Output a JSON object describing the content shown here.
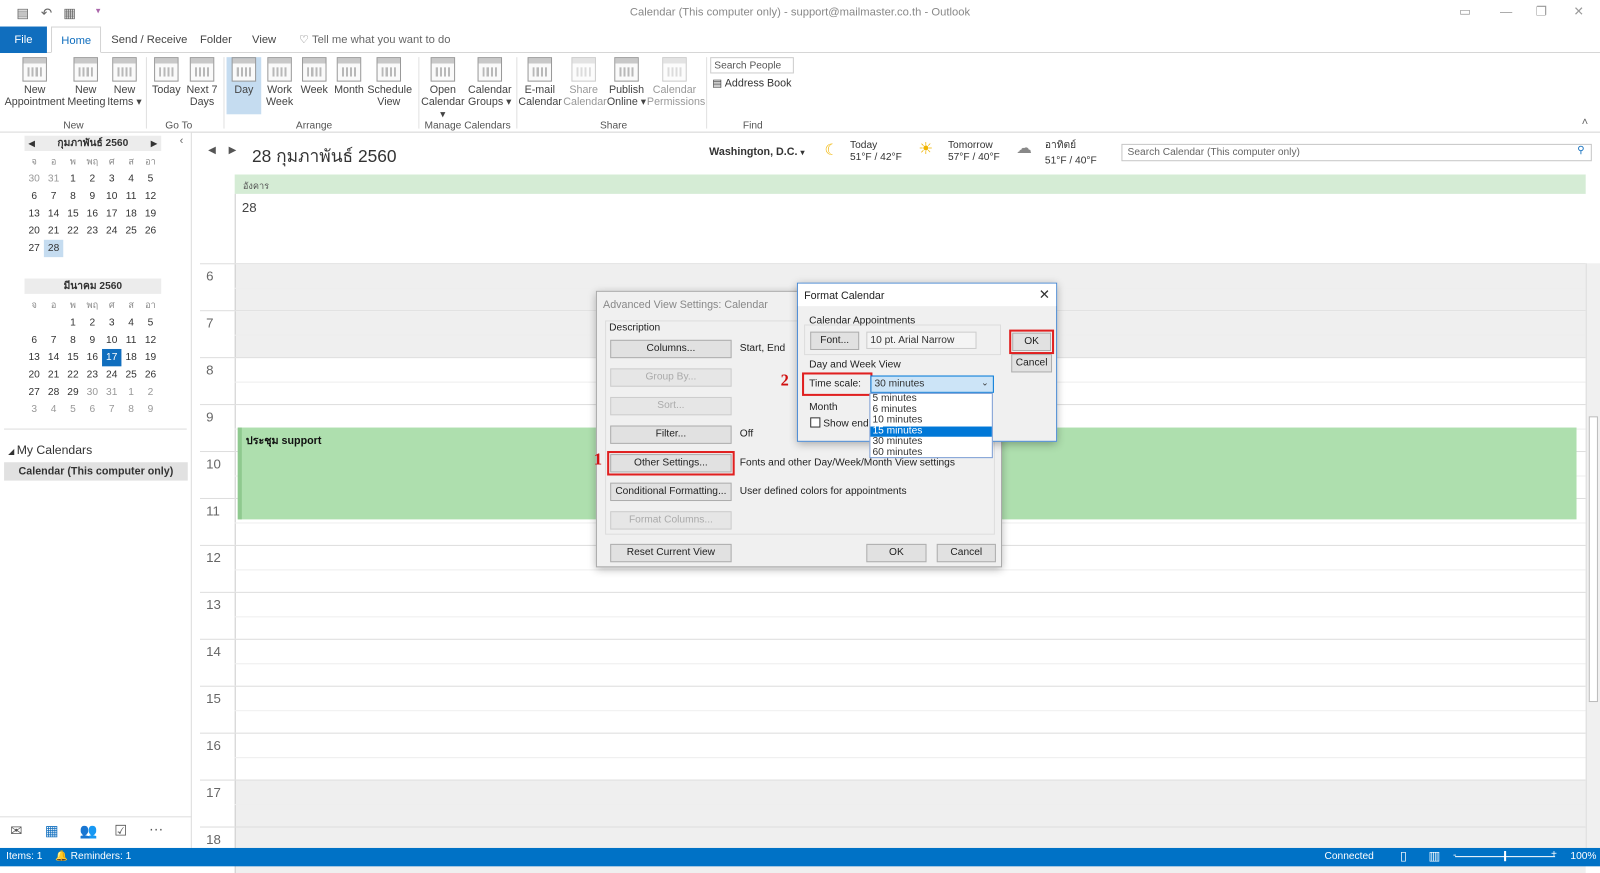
{
  "window": {
    "title": "Calendar (This computer only) - support@mailmaster.co.th  -  Outlook"
  },
  "tabs": [
    {
      "label": "File"
    },
    {
      "label": "Home"
    },
    {
      "label": "Send / Receive"
    },
    {
      "label": "Folder"
    },
    {
      "label": "View"
    }
  ],
  "tell_me": "Tell me what you want to do",
  "ribbon": {
    "buttons": [
      {
        "label": "New Appointment"
      },
      {
        "label": "New Meeting"
      },
      {
        "label": "New Items ▾"
      },
      {
        "label": "Today"
      },
      {
        "label": "Next 7 Days"
      },
      {
        "label": "Day"
      },
      {
        "label": "Work Week"
      },
      {
        "label": "Week"
      },
      {
        "label": "Month"
      },
      {
        "label": "Schedule View"
      },
      {
        "label": "Open Calendar ▾"
      },
      {
        "label": "Calendar Groups ▾"
      },
      {
        "label": "E-mail Calendar"
      },
      {
        "label": "Share Calendar"
      },
      {
        "label": "Publish Online ▾"
      },
      {
        "label": "Calendar Permissions"
      }
    ],
    "groups": [
      "New",
      "Go To",
      "Arrange",
      "Manage Calendars",
      "Share",
      "Find"
    ],
    "search_people": "Search People",
    "address_book": "Address Book"
  },
  "mini_calendars": [
    {
      "title": "กุมภาพันธ์ 2560",
      "day_names": [
        "จ",
        "อ",
        "พ",
        "พฤ",
        "ศ",
        "ส",
        "อา"
      ],
      "days": [
        "30",
        "31",
        "1",
        "2",
        "3",
        "4",
        "5",
        "6",
        "7",
        "8",
        "9",
        "10",
        "11",
        "12",
        "13",
        "14",
        "15",
        "16",
        "17",
        "18",
        "19",
        "20",
        "21",
        "22",
        "23",
        "24",
        "25",
        "26",
        "27",
        "28"
      ],
      "selected": "28"
    },
    {
      "title": "มีนาคม 2560",
      "day_names": [
        "จ",
        "อ",
        "พ",
        "พฤ",
        "ศ",
        "ส",
        "อา"
      ],
      "days": [
        "",
        "",
        "1",
        "2",
        "3",
        "4",
        "5",
        "6",
        "7",
        "8",
        "9",
        "10",
        "11",
        "12",
        "13",
        "14",
        "15",
        "16",
        "17",
        "18",
        "19",
        "20",
        "21",
        "22",
        "23",
        "24",
        "25",
        "26",
        "27",
        "28",
        "29",
        "30",
        "31",
        "1",
        "2",
        "3",
        "4",
        "5",
        "6",
        "7",
        "8",
        "9"
      ],
      "today": "17"
    }
  ],
  "folders": {
    "group": "My Calendars",
    "items": [
      {
        "label": "Calendar (This computer only)"
      }
    ]
  },
  "calendar": {
    "date_title": "28 กุมภาพันธ์ 2560",
    "location": "Washington, D.C.",
    "weather": [
      {
        "day": "Today",
        "temp": "51°F / 42°F",
        "icon": "moon-icon"
      },
      {
        "day": "Tomorrow",
        "temp": "57°F / 40°F",
        "icon": "sun-icon"
      },
      {
        "day": "อาทิตย์",
        "temp": "51°F / 40°F",
        "icon": "cloud-icon"
      }
    ],
    "search_placeholder": "Search Calendar (This computer only)",
    "day_name": "อังคาร",
    "day_number": "28",
    "hours": [
      "6",
      "7",
      "8",
      "9",
      "10",
      "11",
      "12",
      "13",
      "14",
      "15",
      "16",
      "17",
      "18"
    ],
    "appointment": {
      "title": "ประชุม support",
      "color": "#aedfae"
    }
  },
  "advanced_dialog": {
    "title": "Advanced View Settings: Calendar",
    "section": "Description",
    "rows": [
      {
        "button": "Columns...",
        "value": "Start, End",
        "enabled": true
      },
      {
        "button": "Group By...",
        "value": "",
        "enabled": false
      },
      {
        "button": "Sort...",
        "value": "",
        "enabled": false
      },
      {
        "button": "Filter...",
        "value": "Off",
        "enabled": true
      },
      {
        "button": "Other Settings...",
        "value": "Fonts and other Day/Week/Month View settings",
        "enabled": true
      },
      {
        "button": "Conditional Formatting...",
        "value": "User defined colors for appointments",
        "enabled": true
      },
      {
        "button": "Format Columns...",
        "value": "",
        "enabled": false
      }
    ],
    "reset": "Reset Current View",
    "ok": "OK",
    "cancel": "Cancel"
  },
  "format_dialog": {
    "title": "Format Calendar",
    "appointments_section": "Calendar Appointments",
    "font_button": "Font...",
    "font_value": "10 pt. Arial Narrow",
    "day_week_section": "Day and Week View",
    "time_scale_label": "Time scale:",
    "time_scale_value": "30 minutes",
    "time_scale_options": [
      "5 minutes",
      "6 minutes",
      "10 minutes",
      "15 minutes",
      "30 minutes",
      "60 minutes"
    ],
    "highlighted_option": "15 minutes",
    "month_section": "Month",
    "show_end_label": "Show end",
    "ok": "OK",
    "cancel": "Cancel"
  },
  "annotations": {
    "step1": "1",
    "step2": "2"
  },
  "status": {
    "items": "Items: 1",
    "reminders": "Reminders: 1",
    "connection": "Connected",
    "zoom": "100%"
  },
  "colors": {
    "accent": "#0072c6",
    "highlight_red": "#e02020"
  }
}
